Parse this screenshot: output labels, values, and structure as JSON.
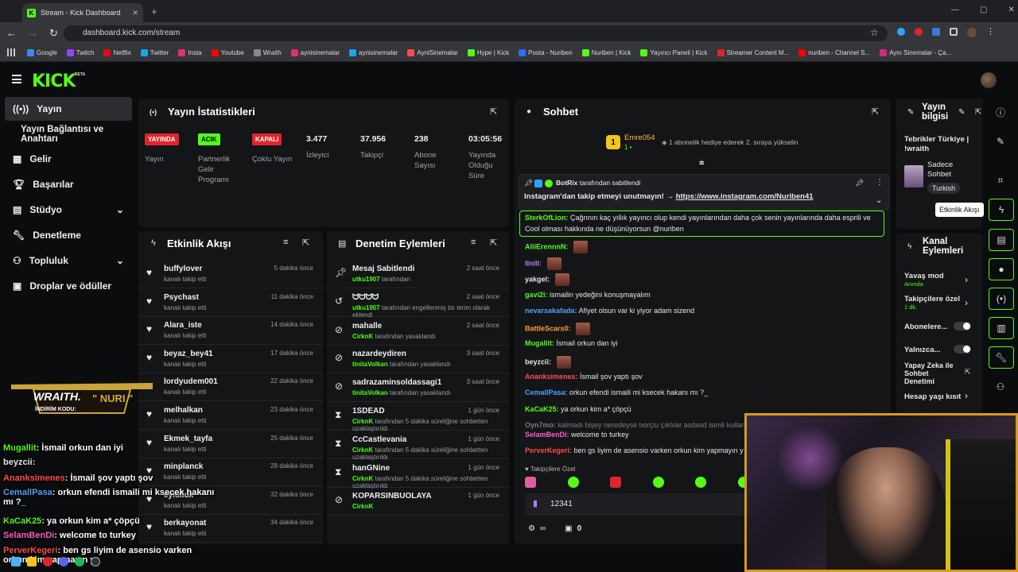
{
  "browser": {
    "tab_title": "Stream - Kick Dashboard",
    "url": "dashboard.kick.com/stream",
    "bookmarks": [
      "Google",
      "Twitch",
      "Netflix",
      "Twitter",
      "Insta",
      "Youtube",
      "Wraith",
      "aynisinemalar",
      "aynisinemalar",
      "AyniSinemalar",
      "Hype | Kick",
      "Posta - Nuriben",
      "Nuriben | Kick",
      "Yayıncı Paneli | Kick",
      "Streamer Content M...",
      "nuriben - Channel S...",
      "Aynı Sinemalar - Ça..."
    ]
  },
  "brand": {
    "logo": "KICK",
    "beta": "BETA",
    "accent": "#53fc18"
  },
  "sidebar": {
    "items": [
      {
        "label": "Yayın",
        "icon": "broadcast-icon"
      },
      {
        "label": "Yayın Bağlantısı ve Anahtarı",
        "icon": ""
      },
      {
        "label": "Gelir",
        "icon": "revenue-icon"
      },
      {
        "label": "Başarılar",
        "icon": "trophy-icon"
      },
      {
        "label": "Stüdyo",
        "icon": "studio-icon"
      },
      {
        "label": "Denetleme",
        "icon": "wrench-icon"
      },
      {
        "label": "Topluluk",
        "icon": "community-icon"
      },
      {
        "label": "Droplar ve ödüller",
        "icon": "gift-icon"
      }
    ]
  },
  "stats": {
    "title": "Yayın İstatistikleri",
    "items": [
      {
        "badge": "YAYINDA",
        "label": "Yayın"
      },
      {
        "badge": "ACIK",
        "label": "Partnerlik Gelir Programı"
      },
      {
        "badge": "KAPALI",
        "label": "Çoklu Yayın"
      },
      {
        "value": "3.477",
        "label": "İzleyici"
      },
      {
        "value": "37.956",
        "label": "Takipçi"
      },
      {
        "value": "238",
        "label": "Abone Sayısı"
      },
      {
        "value": "03:05:56",
        "label": "Yayında Olduğu Süre"
      }
    ]
  },
  "activity": {
    "title": "Etkinlik Akışı",
    "rows": [
      {
        "name": "buffylover",
        "sub": "kanalı takip etti",
        "time": "5 dakika önce"
      },
      {
        "name": "Psychast",
        "sub": "kanalı takip etti",
        "time": "11 dakika önce"
      },
      {
        "name": "Alara_iste",
        "sub": "kanalı takip etti",
        "time": "14 dakika önce"
      },
      {
        "name": "beyaz_bey41",
        "sub": "kanalı takip etti",
        "time": "17 dakika önce"
      },
      {
        "name": "lordyudem001",
        "sub": "kanalı takip etti",
        "time": "22 dakika önce"
      },
      {
        "name": "melhalkan",
        "sub": "kanalı takip etti",
        "time": "23 dakika önce"
      },
      {
        "name": "Ekmek_tayfa",
        "sub": "kanalı takip etti",
        "time": "25 dakika önce"
      },
      {
        "name": "minplanck",
        "sub": "kanalı takip etti",
        "time": "28 dakika önce"
      },
      {
        "name": "eylulluk",
        "sub": "kanalı takip etti",
        "time": "32 dakika önce"
      },
      {
        "name": "berkayonat",
        "sub": "kanalı takip etti",
        "time": "34 dakika önce"
      }
    ]
  },
  "moderation": {
    "title": "Denetim Eylemleri",
    "rows": [
      {
        "name": "Mesaj Sabitlendi",
        "mod": "utku1907",
        "sub": "tarafından",
        "time": "2 saat önce",
        "icon": "pin-icon"
      },
      {
        "name": "ᗢᗢᗢᗢ",
        "mod": "utku1907",
        "sub": "tarafından engellenmiş bir terim olarak eklendi",
        "time": "2 saat önce",
        "icon": "history-icon"
      },
      {
        "name": "mahalle",
        "mod": "CirknK",
        "sub": "tarafından yasaklandı",
        "time": "2 saat önce",
        "icon": "ban-icon"
      },
      {
        "name": "nazardeydiren",
        "mod": "tinitaVolkan",
        "sub": "tarafından yasaklandı",
        "time": "3 saat önce",
        "icon": "ban-icon"
      },
      {
        "name": "sadrazaminsoldassagi1",
        "mod": "tinitaVolkan",
        "sub": "tarafından yasaklandı",
        "time": "3 saat önce",
        "icon": "ban-icon"
      },
      {
        "name": "1SDEAD",
        "mod": "CirknK",
        "sub": "tarafından 5 dakika süreliğine sohbetten uzaklaştırıldı",
        "time": "1 gün önce",
        "icon": "timeout-icon"
      },
      {
        "name": "CcCastlevania",
        "mod": "CirknK",
        "sub": "tarafından 5 dakika süreliğine sohbetten uzaklaştırıldı",
        "time": "1 gün önce",
        "icon": "timeout-icon"
      },
      {
        "name": "hanGNine",
        "mod": "CirknK",
        "sub": "tarafından 5 dakika süreliğine sohbetten uzaklaştırıldı",
        "time": "1 gün önce",
        "icon": "timeout-icon"
      },
      {
        "name": "KOPARSINBUOLAYA",
        "mod": "CirknK",
        "sub": "",
        "time": "1 gün önce",
        "icon": "ban-icon"
      }
    ]
  },
  "chat": {
    "title": "Sohbet",
    "gift_user": "Emre054",
    "gift_text": "1 abonelik hediye ederek 2. sıraya yükselin",
    "pinned_by": "BotRix",
    "pinned_by_text": "tarafından sabitlendi",
    "pinned_msg": "Instagram'dan takip etmeyi unutmayın! →",
    "pinned_link": "https://www.instagram.com/Nuriben41",
    "messages": [
      {
        "user": "SterkOfLion:",
        "color": "#53fc18",
        "text": "Çağrının kaç yıllık yayıncı olup kendi yayınlarından daha çok senin yayınlarında daha esprili ve"
      },
      {
        "user": "",
        "color": "#e6e6e6",
        "text": "Cool olması hakkında ne düşünüyorsun @nuriben"
      },
      {
        "user": "AliiErennnN:",
        "color": "#53fc18",
        "text": ""
      },
      {
        "user": "llnill:",
        "color": "#b57cff",
        "text": ""
      },
      {
        "user": "yakgel:",
        "color": "#e6e6e6",
        "text": ""
      },
      {
        "user": "gavi2i:",
        "color": "#53fc18",
        "text": "ismailin yedeğini konuşmayalım"
      },
      {
        "user": "nevarsakafada:",
        "color": "#4aa3ff",
        "text": "Afiyet olsun var ki yiyor adam sizend"
      },
      {
        "user": "BattleScars0:",
        "color": "#ff9f2e",
        "text": ""
      },
      {
        "user": "Mugallit:",
        "color": "#53fc18",
        "text": "İsmail orkun dan iyi"
      },
      {
        "user": "beyzcii:",
        "color": "#e6e6e6",
        "text": ""
      },
      {
        "user": "Ananksimenes:",
        "color": "#ff4d4d",
        "text": "İsmail şov yaptı şov"
      },
      {
        "user": "CemallPasa:",
        "color": "#4aa3ff",
        "text": "orkun efendi ismaili mi ksecek hakanı mı ?_"
      },
      {
        "user": "KaCaK25:",
        "color": "#53fc18",
        "text": "ya orkun kim a* çöpçü"
      },
      {
        "user": "Oyn7mo:",
        "color": "#7a7d82",
        "text": "kalmadı bişey neredeyse borçlu çıktılar asdasd isimli kullanıc"
      },
      {
        "user": "SelamBenDi:",
        "color": "#ff5cc8",
        "text": "welcome to turkey"
      },
      {
        "user": "PerverKegeri:",
        "color": "#ff4d4d",
        "text": "ben gs liyim de asensio varken orkun kim yapmayın y"
      }
    ],
    "follower_only": "Takipçilere Özel",
    "input_value": "12341",
    "footer_count": "0"
  },
  "stream_info": {
    "title": "Yayın bilgisi",
    "stream_title": "Tebrikler Türkiye | !wraith",
    "category": "Sadece Sohbet",
    "tag": "Turkish"
  },
  "channel_actions": {
    "title": "Kanal Eylemleri",
    "items": [
      {
        "label": "Yavaş mod",
        "sub": "Anında",
        "kind": "arrow"
      },
      {
        "label": "Takipçilere özel",
        "sub": "1 dk.",
        "kind": "arrow"
      },
      {
        "label": "Abonelere...",
        "sub": "",
        "kind": "toggle"
      },
      {
        "label": "Yalnızca...",
        "sub": "",
        "kind": "toggle"
      },
      {
        "label": "Yapay Zeka ile Sohbet Denetimi",
        "sub": "",
        "kind": "link"
      },
      {
        "label": "Hesap yaşı kısıt",
        "sub": "",
        "kind": "arrow"
      }
    ]
  },
  "tooltip": "Etkinlik Akışı",
  "overlay": {
    "brand": "WRAITH.",
    "code_label": "İNDİRİM KODU:",
    "code": "\" NURI \"",
    "lines": [
      {
        "user": "Mugallit",
        "color": "#53fc18",
        "text": ": İsmail orkun dan iyi"
      },
      {
        "user": "beyzcii",
        "color": "#e6e6e6",
        "text": ": "
      },
      {
        "user": "Ananksimenes",
        "color": "#ff4d4d",
        "text": ": İsmail şov yaptı şov"
      },
      {
        "user": "CemallPasa",
        "color": "#4aa3ff",
        "text": ": orkun efendi ismaili mi ksecek hakanı mı ?_"
      },
      {
        "user": "KaCaK25",
        "color": "#53fc18",
        "text": ": ya orkun kim a* çöpçü"
      },
      {
        "user": "SelamBenDi",
        "color": "#ff5cc8",
        "text": ": welcome to turkey"
      },
      {
        "user": "PerverKegeri",
        "color": "#ff4d4d",
        "text": ": ben gs liyim de asensio varken orkun kim yapmayın ya"
      }
    ]
  }
}
